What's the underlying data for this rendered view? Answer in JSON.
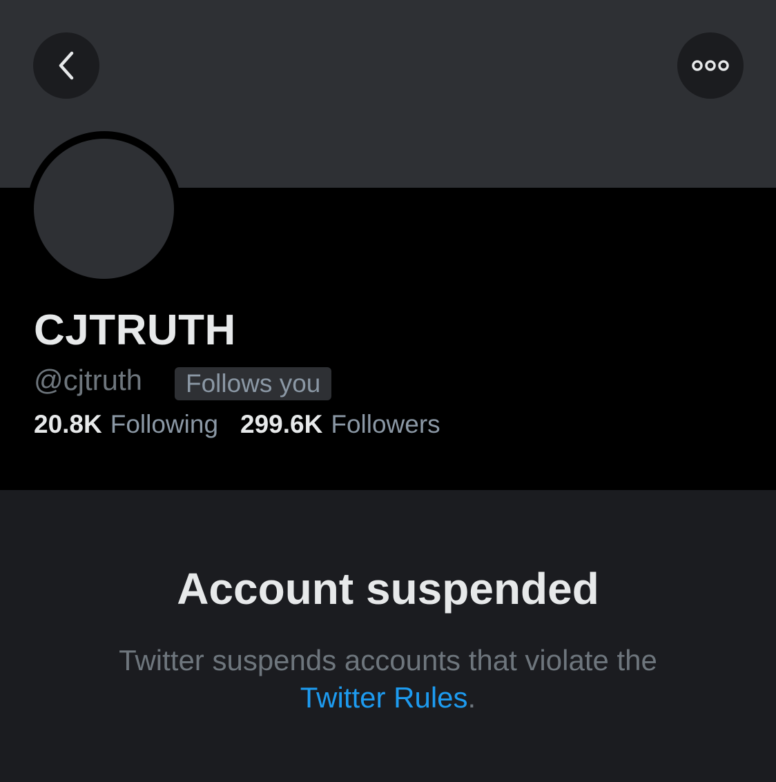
{
  "header": {
    "back_icon": "chevron-left-icon",
    "more_icon": "more-horizontal-icon"
  },
  "profile": {
    "display_name": "CJTRUTH",
    "handle": "@cjtruth",
    "follows_you_label": "Follows you",
    "following_count": "20.8K",
    "following_label": "Following",
    "followers_count": "299.6K",
    "followers_label": "Followers"
  },
  "suspension": {
    "title": "Account suspended",
    "description": "Twitter suspends accounts that violate the",
    "link_text": "Twitter Rules",
    "trailing_text": "."
  },
  "colors": {
    "banner": "#2e3034",
    "background": "#000000",
    "panel": "#1b1c20",
    "link": "#1d9bf0",
    "primary_text": "#e7e9ea",
    "secondary_text": "#6e767d"
  }
}
